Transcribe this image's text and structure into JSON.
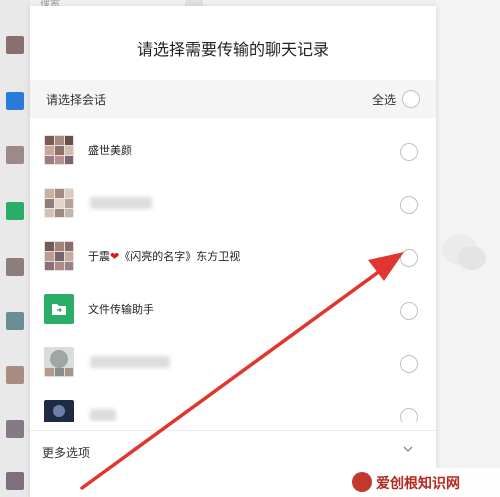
{
  "dialog": {
    "title": "请选择需要传输的聊天记录",
    "section_label": "请选择会话",
    "select_all_label": "全选",
    "more_options_label": "更多选项"
  },
  "conversations": [
    {
      "name": "盛世美颜",
      "avatar": "group-avatar"
    },
    {
      "name": "",
      "avatar": "group-avatar"
    },
    {
      "name": "于震❤《闪亮的名字》东方卫视",
      "avatar": "group-avatar"
    },
    {
      "name": "文件传输助手",
      "avatar": "file-transfer-icon"
    },
    {
      "name": "",
      "avatar": "group-avatar"
    },
    {
      "name": "",
      "avatar": "user-avatar"
    }
  ],
  "background": {
    "search_placeholder": "搜索"
  },
  "watermark": {
    "text": "爱创根知识网"
  },
  "colors": {
    "accent_green": "#2aae67",
    "arrow_red": "#e0362f",
    "radio_border": "#c2c2c2"
  }
}
